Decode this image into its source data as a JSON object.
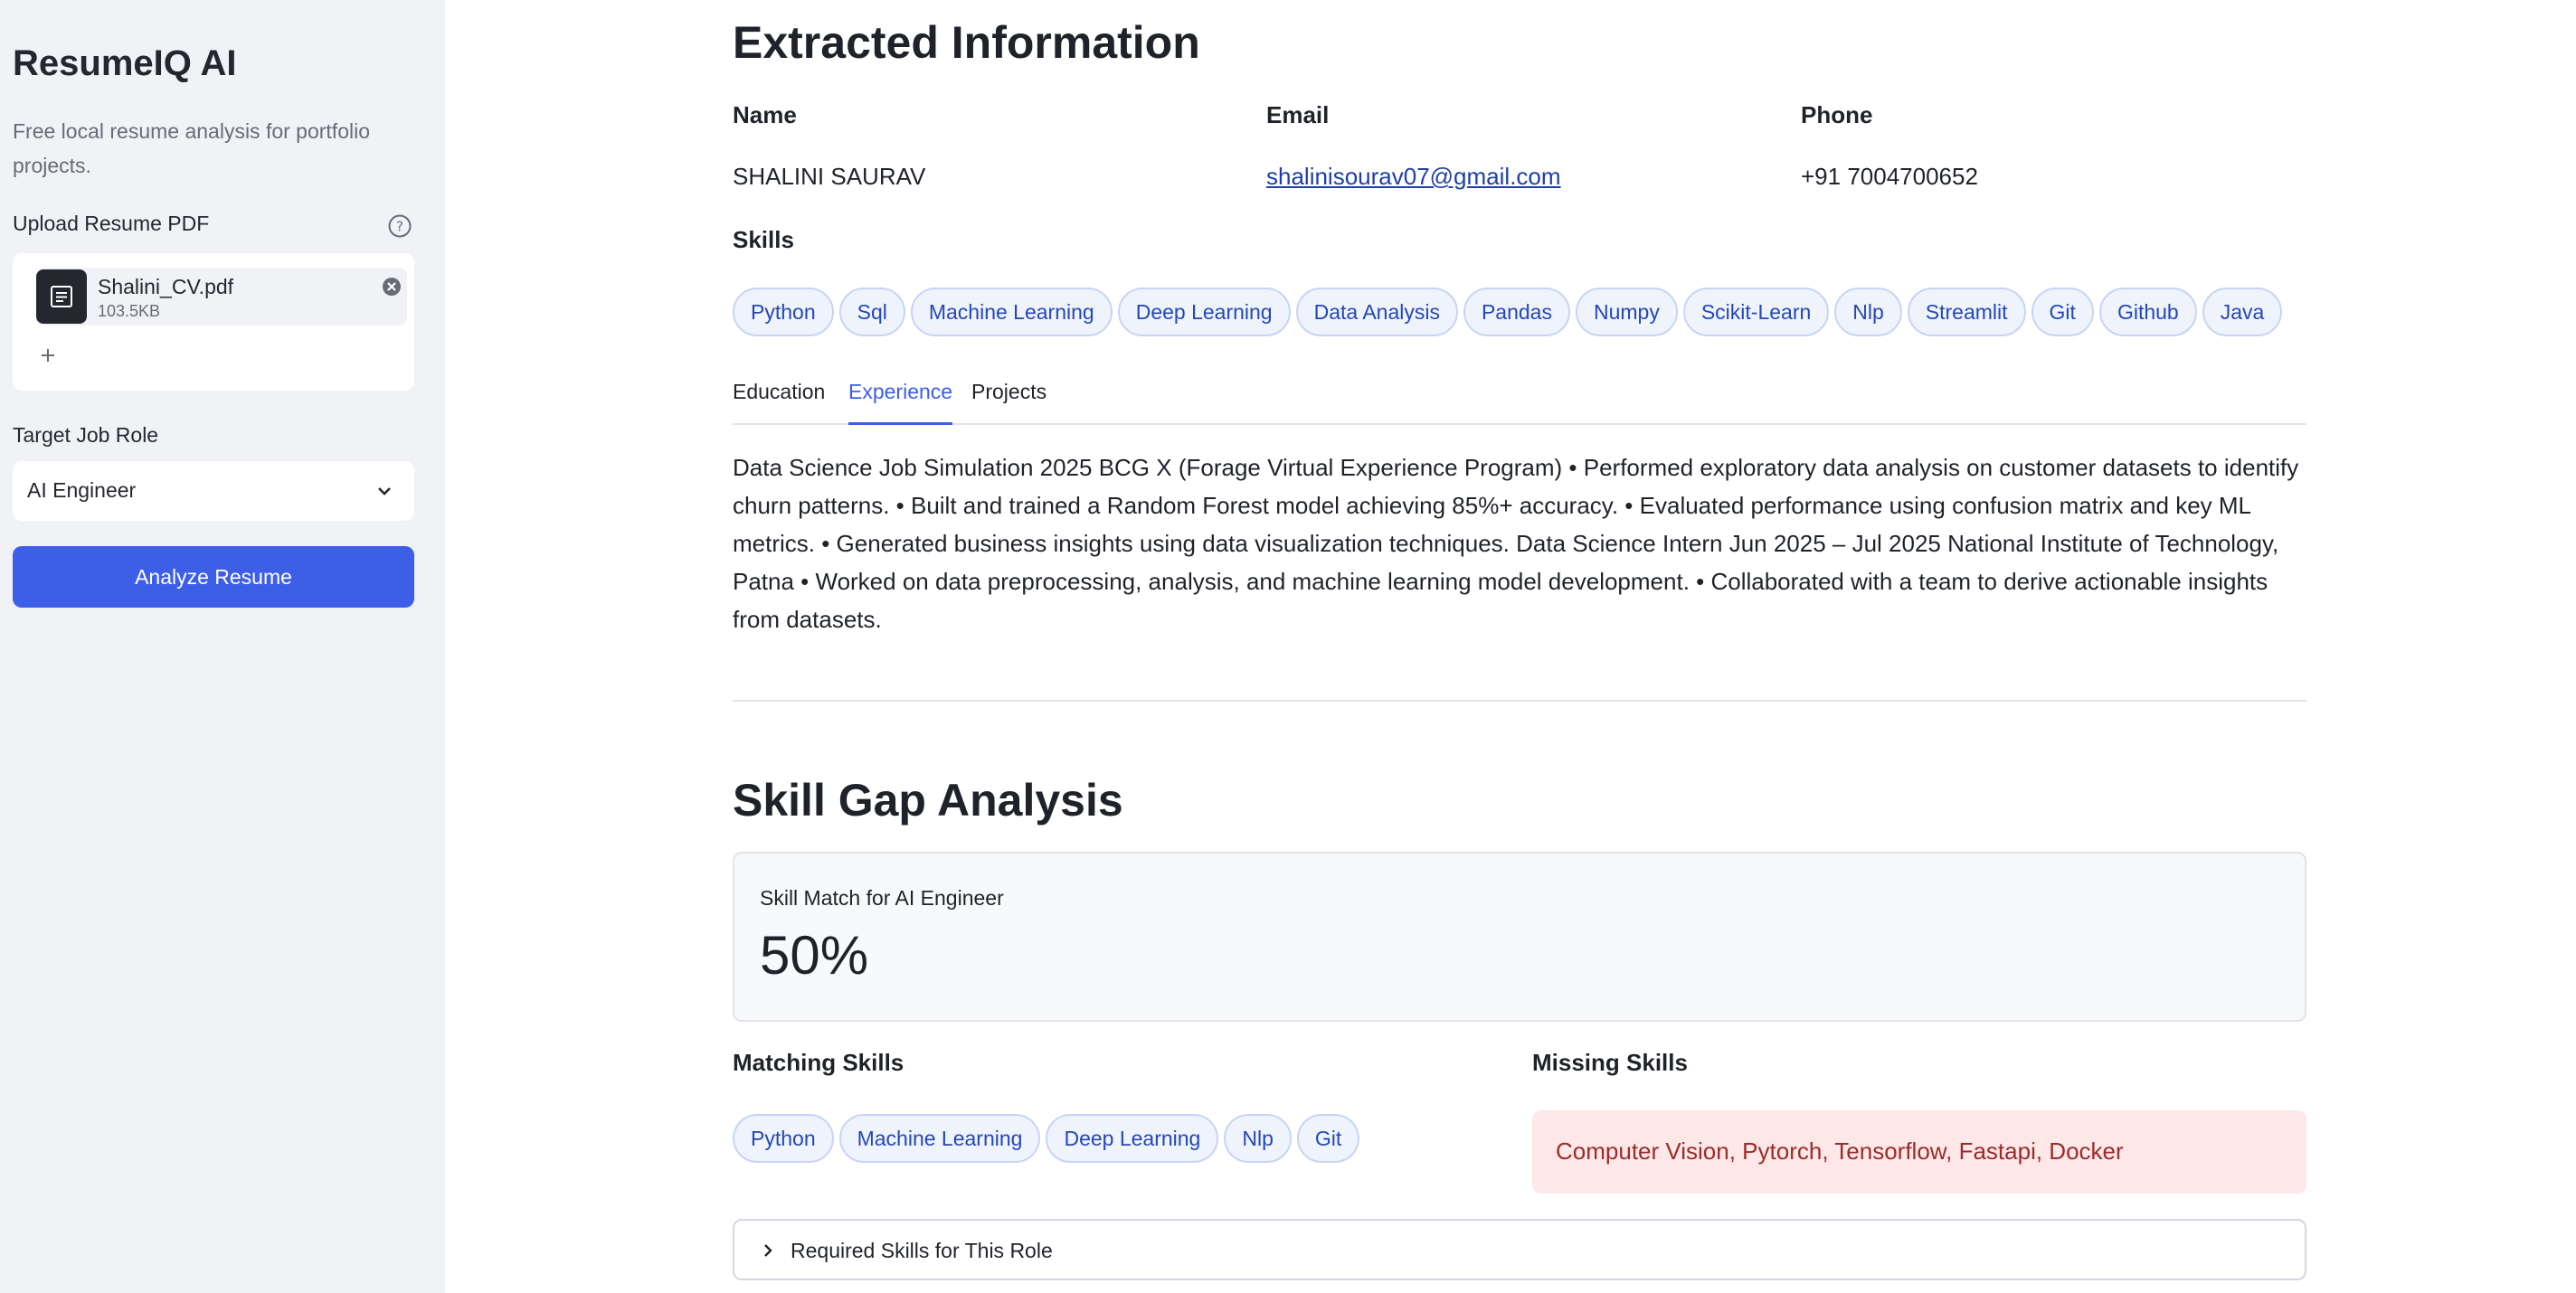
{
  "sidebar": {
    "title": "ResumeIQ AI",
    "description": "Free local resume analysis for portfolio projects.",
    "upload_label": "Upload Resume PDF",
    "file": {
      "name": "Shalini_CV.pdf",
      "size": "103.5KB"
    },
    "role_label": "Target Job Role",
    "role_value": "AI Engineer",
    "analyze_label": "Analyze Resume"
  },
  "extracted": {
    "heading": "Extracted Information",
    "name_label": "Name",
    "name_value": "SHALINI SAURAV",
    "email_label": "Email",
    "email_value": "shalinisourav07@gmail.com",
    "phone_label": "Phone",
    "phone_value": "+91 7004700652",
    "skills_label": "Skills",
    "skills": [
      "Python",
      "Sql",
      "Machine Learning",
      "Deep Learning",
      "Data Analysis",
      "Pandas",
      "Numpy",
      "Scikit-Learn",
      "Nlp",
      "Streamlit",
      "Git",
      "Github",
      "Java"
    ]
  },
  "tabs": [
    {
      "label": "Education",
      "active": false
    },
    {
      "label": "Experience",
      "active": true
    },
    {
      "label": "Projects",
      "active": false
    }
  ],
  "experience_text": "Data Science Job Simulation 2025 BCG X (Forage Virtual Experience Program) • Performed exploratory data analysis on customer datasets to identify churn patterns. • Built and trained a Random Forest model achieving 85%+ accuracy. • Evaluated performance using confusion matrix and key ML metrics. • Generated business insights using data visualization techniques. Data Science Intern Jun 2025 – Jul 2025 National Institute of Technology, Patna • Worked on data preprocessing, analysis, and machine learning model development. • Collaborated with a team to derive actionable insights from datasets.",
  "gap": {
    "heading": "Skill Gap Analysis",
    "metric_label": "Skill Match for AI Engineer",
    "metric_value": "50%",
    "matching_label": "Matching Skills",
    "matching": [
      "Python",
      "Machine Learning",
      "Deep Learning",
      "Nlp",
      "Git"
    ],
    "missing_label": "Missing Skills",
    "missing_text": "Computer Vision, Pytorch, Tensorflow, Fastapi, Docker",
    "expander_label": "Required Skills for This Role"
  },
  "colors": {
    "accent": "#3d5ee6",
    "chip_bg": "#eef3fc",
    "missing_bg": "#fde7e7",
    "missing_text": "#9c2b2b"
  }
}
